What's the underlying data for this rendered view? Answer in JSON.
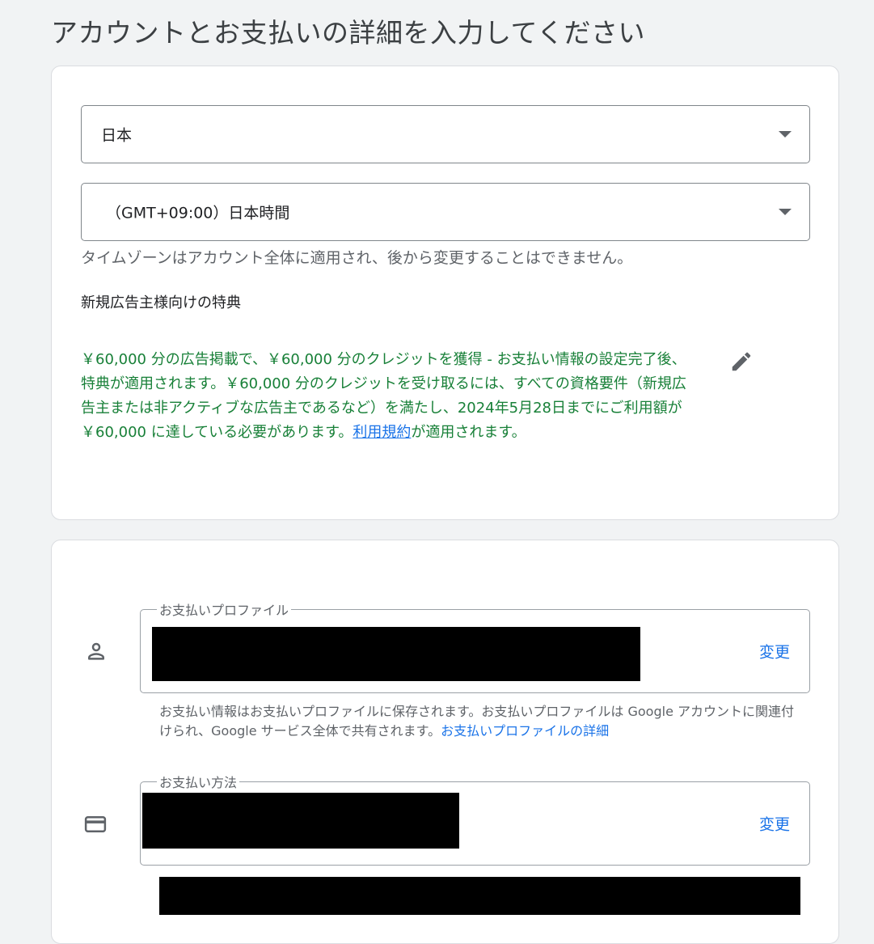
{
  "page": {
    "title": "アカウントとお支払いの詳細を入力してください"
  },
  "account": {
    "country": {
      "value": "日本",
      "icon": "dropdown-arrow-icon"
    },
    "timezone": {
      "value": "（GMT+09:00）日本時間",
      "icon": "dropdown-arrow-icon",
      "hint": "タイムゾーンはアカウント全体に適用され、後から変更することはできません。"
    }
  },
  "promo": {
    "heading": "新規広告主様向けの特典",
    "text": "￥60,000 分の広告掲載で、￥60,000 分のクレジットを獲得 - お支払い情報の設定完了後、特典が適用されます。￥60,000 分のクレジットを受け取るには、すべての資格要件（新規広告主または非アクティブな広告主であるなど）を満たし、2024年5月28日までにご利用額が ￥60,000 に達している必要があります。",
    "terms_link": "利用規約",
    "terms_suffix": "が適用されます。",
    "edit_icon": "pencil-icon",
    "text_color": "#188038"
  },
  "billing": {
    "profile": {
      "label": "お支払いプロファイル",
      "change": "変更",
      "icon": "person-icon",
      "note": "お支払い情報はお支払いプロファイルに保存されます。お支払いプロファイルは Google アカウントに関連付けられ、Google サービス全体で共有されます。",
      "note_link": "お支払いプロファイルの詳細"
    },
    "method": {
      "label": "お支払い方法",
      "change": "変更",
      "icon": "credit-card-icon"
    }
  },
  "colors": {
    "background": "#f1f3f4",
    "link": "#1a73e8",
    "promo_text": "#188038",
    "secondary_text": "#5f6368"
  }
}
